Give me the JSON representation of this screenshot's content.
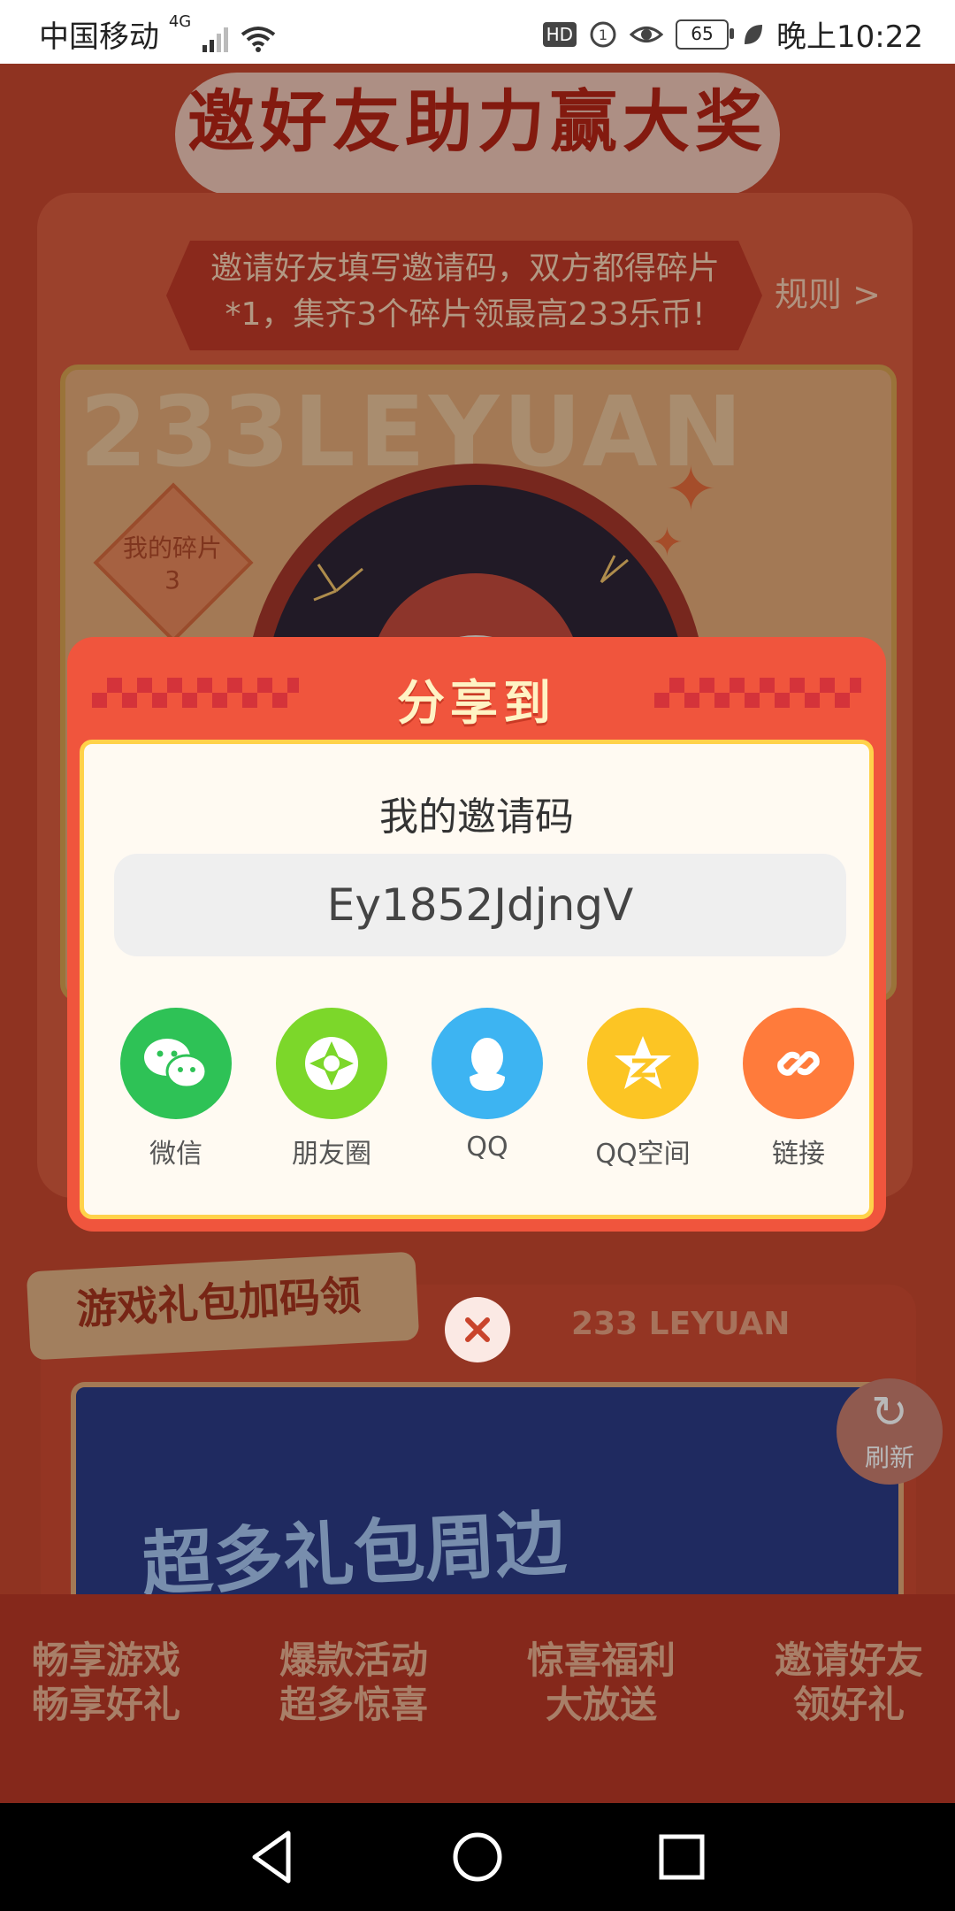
{
  "status_bar": {
    "carrier": "中国移动",
    "network": "4G",
    "hd": "HD",
    "battery": "65",
    "time": "晚上10:22"
  },
  "background": {
    "page_title": "邀好友助力赢大奖",
    "banner_text": "邀请好友填写邀请码，双方都得碎片*1，集齐3个碎片领最高233乐币!",
    "rule_link": "规则 >",
    "watermark": "233LEYUAN",
    "fragments_label": "我的碎片",
    "fragments_count": "3",
    "section2_title": "游戏礼包加码领",
    "leyuan_text": "233 LEYUAN",
    "banner_headline": "超多礼包周边",
    "refresh_label": "刷新",
    "bottom_items": [
      {
        "line1": "畅享游戏",
        "line2": "畅享好礼"
      },
      {
        "line1": "爆款活动",
        "line2": "超多惊喜"
      },
      {
        "line1": "惊喜福利",
        "line2": "大放送"
      },
      {
        "line1": "邀请好友",
        "line2": "领好礼"
      }
    ]
  },
  "share_dialog": {
    "title": "分享到",
    "code_label": "我的邀请码",
    "invite_code": "Ey1852JdjngV",
    "targets": [
      {
        "label": "微信",
        "icon": "wechat-icon",
        "color": "#2ec256"
      },
      {
        "label": "朋友圈",
        "icon": "moments-icon",
        "color": "#7cd72a"
      },
      {
        "label": "QQ",
        "icon": "qq-icon",
        "color": "#3db4f2"
      },
      {
        "label": "QQ空间",
        "icon": "qzone-icon",
        "color": "#fcc524"
      },
      {
        "label": "链接",
        "icon": "link-icon",
        "color": "#ff7b3b"
      }
    ]
  },
  "colors": {
    "dialog_red": "#f0553d",
    "panel_border": "#ffd24a"
  }
}
